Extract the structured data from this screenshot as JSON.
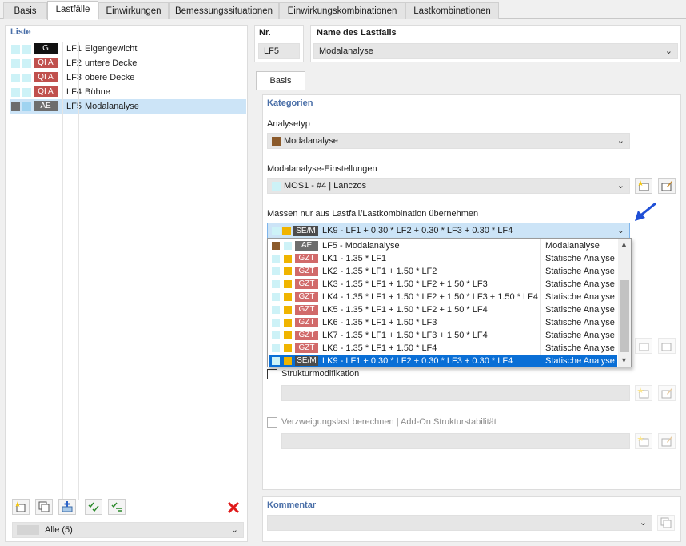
{
  "tabs": [
    "Basis",
    "Lastfälle",
    "Einwirkungen",
    "Bemessungssituationen",
    "Einwirkungskombinationen",
    "Lastkombinationen"
  ],
  "list": {
    "title": "Liste",
    "items": [
      {
        "badge": "G",
        "id": "LF1",
        "name": "Eigengewicht"
      },
      {
        "badge": "QI A",
        "id": "LF2",
        "name": "untere Decke"
      },
      {
        "badge": "QI A",
        "id": "LF3",
        "name": "obere Decke"
      },
      {
        "badge": "QI A",
        "id": "LF4",
        "name": "Bühne"
      },
      {
        "badge": "AE",
        "id": "LF5",
        "name": "Modalanalyse"
      }
    ],
    "filter": "Alle (5)"
  },
  "header": {
    "nr_label": "Nr.",
    "nr_value": "LF5",
    "name_label": "Name des Lastfalls",
    "name_value": "Modalanalyse"
  },
  "subtab": "Basis",
  "kategorien": {
    "title": "Kategorien",
    "analysetyp_label": "Analysetyp",
    "analysetyp_value": "Modalanalyse",
    "modal_label": "Modalanalyse-Einstellungen",
    "modal_value": "MOS1 - #4 | Lanczos",
    "massen_label": "Massen nur aus Lastfall/Lastkombination übernehmen",
    "massen_badge": "SE/M",
    "massen_value": "LK9 - LF1 + 0.30 * LF2 + 0.30 * LF3 + 0.30 * LF4"
  },
  "dropdown": [
    {
      "badge": "AE",
      "text": "LF5 - Modalanalyse",
      "type": "Modalanalyse"
    },
    {
      "badge": "GZT",
      "text": "LK1 - 1.35 * LF1",
      "type": "Statische Analyse"
    },
    {
      "badge": "GZT",
      "text": "LK2 - 1.35 * LF1 + 1.50 * LF2",
      "type": "Statische Analyse"
    },
    {
      "badge": "GZT",
      "text": "LK3 - 1.35 * LF1 + 1.50 * LF2 + 1.50 * LF3",
      "type": "Statische Analyse"
    },
    {
      "badge": "GZT",
      "text": "LK4 - 1.35 * LF1 + 1.50 * LF2 + 1.50 * LF3 + 1.50 * LF4",
      "type": "Statische Analyse"
    },
    {
      "badge": "GZT",
      "text": "LK5 - 1.35 * LF1 + 1.50 * LF2 + 1.50 * LF4",
      "type": "Statische Analyse"
    },
    {
      "badge": "GZT",
      "text": "LK6 - 1.35 * LF1 + 1.50 * LF3",
      "type": "Statische Analyse"
    },
    {
      "badge": "GZT",
      "text": "LK7 - 1.35 * LF1 + 1.50 * LF3 + 1.50 * LF4",
      "type": "Statische Analyse"
    },
    {
      "badge": "GZT",
      "text": "LK8 - 1.35 * LF1 + 1.50 * LF4",
      "type": "Statische Analyse"
    },
    {
      "badge": "SE/M",
      "text": "LK9 - LF1 + 0.30 * LF2 + 0.30 * LF3 + 0.30 * LF4",
      "type": "Statische Analyse"
    }
  ],
  "options": {
    "struktur_label": "Strukturmodifikation",
    "verzweigung_label": "Verzweigungslast berechnen | Add-On Strukturstabilität"
  },
  "kommentar": {
    "title": "Kommentar"
  },
  "icons": {
    "dropdown_arrow": "chevron-down-icon",
    "delete": "delete-x-icon",
    "pointer": "blue-arrow-icon"
  },
  "colors": {
    "badge_g": "#111111",
    "badge_qi": "#c0504d",
    "badge_ae": "#6d6d6d",
    "badge_gzt": "#d16a6a",
    "badge_sem": "#4c4c4c",
    "modal_brown": "#8b5a2b",
    "mos_cyan": "#cdf2f7",
    "lk_yellow": "#f0b400",
    "selection_blue": "#0a6fd6",
    "section_title": "#4a6fa8"
  }
}
